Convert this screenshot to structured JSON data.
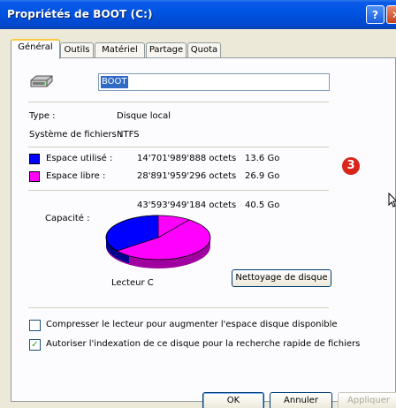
{
  "window": {
    "title": "Propriétés de BOOT (C:)",
    "help_glyph": "?",
    "close_glyph": "✕"
  },
  "tabs": [
    "Général",
    "Outils",
    "Matériel",
    "Partage",
    "Quota"
  ],
  "general": {
    "volume_name": "BOOT",
    "type_label": "Type :",
    "type_value": "Disque local",
    "fs_label": "Système de fichiers :",
    "fs_value": "NTFS",
    "used": {
      "label": "Espace utilisé :",
      "bytes": "14'701'989'888 octets",
      "size": "13.6 Go",
      "color": "#0000ff"
    },
    "free": {
      "label": "Espace libre :",
      "bytes": "28'891'959'296 octets",
      "size": "26.9 Go",
      "color": "#ff00ff"
    },
    "capacity": {
      "label": "Capacité :",
      "bytes": "43'593'949'184 octets",
      "size": "40.5 Go"
    },
    "drive_label": "Lecteur C",
    "cleanup_button": "Nettoyage de disque",
    "compress_label": "Compresser le lecteur pour augmenter l'espace disque disponible",
    "compress_checked": false,
    "index_label": "Autoriser l'indexation de ce disque pour la recherche rapide de fichiers",
    "index_checked": true
  },
  "buttons": {
    "ok": "OK",
    "cancel": "Annuler",
    "apply": "Appliquer"
  },
  "annotation": {
    "number": "3",
    "color": "#d9261c"
  }
}
